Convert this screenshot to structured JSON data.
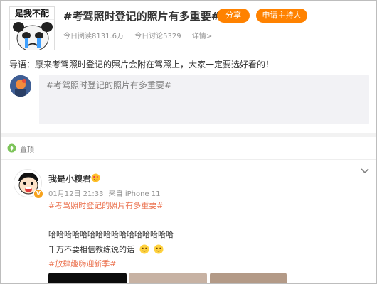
{
  "topic": {
    "avatar_caption": "是我不配",
    "title": "#考驾照时登记的照片有多重要#",
    "share_label": "分享",
    "apply_host_label": "申请主持人",
    "stats": {
      "reads": "今日阅读8131.6万",
      "discussions": "今日讨论5329",
      "details": "详情>"
    }
  },
  "intro": "导语：原来考驾照时登记的照片会附在驾照上，大家一定要选好看的！",
  "compose": {
    "placeholder": "#考驾照时登记的照片有多重要#"
  },
  "pinned": {
    "label": "置顶"
  },
  "post": {
    "author": "我是小糗君",
    "time": "01月12日 21:33",
    "source": "来自 iPhone 11",
    "topic_link": "#考驾照时登记的照片有多重要#",
    "line1": "哈哈哈哈哈哈哈哈哈哈哈哈哈哈哈哈",
    "line2": "千万不要相信教练说的话",
    "tag": "#放肆趣嗨迎新季#"
  },
  "colors": {
    "accent_orange": "#ff8200",
    "link_orange": "#eb7350",
    "muted_text": "#939393"
  },
  "icons": {
    "pin": "green-pin-icon",
    "chevron": "chevron-down-icon",
    "vip": "vip-badge-icon",
    "emoji": "smile-emoji-icon"
  }
}
